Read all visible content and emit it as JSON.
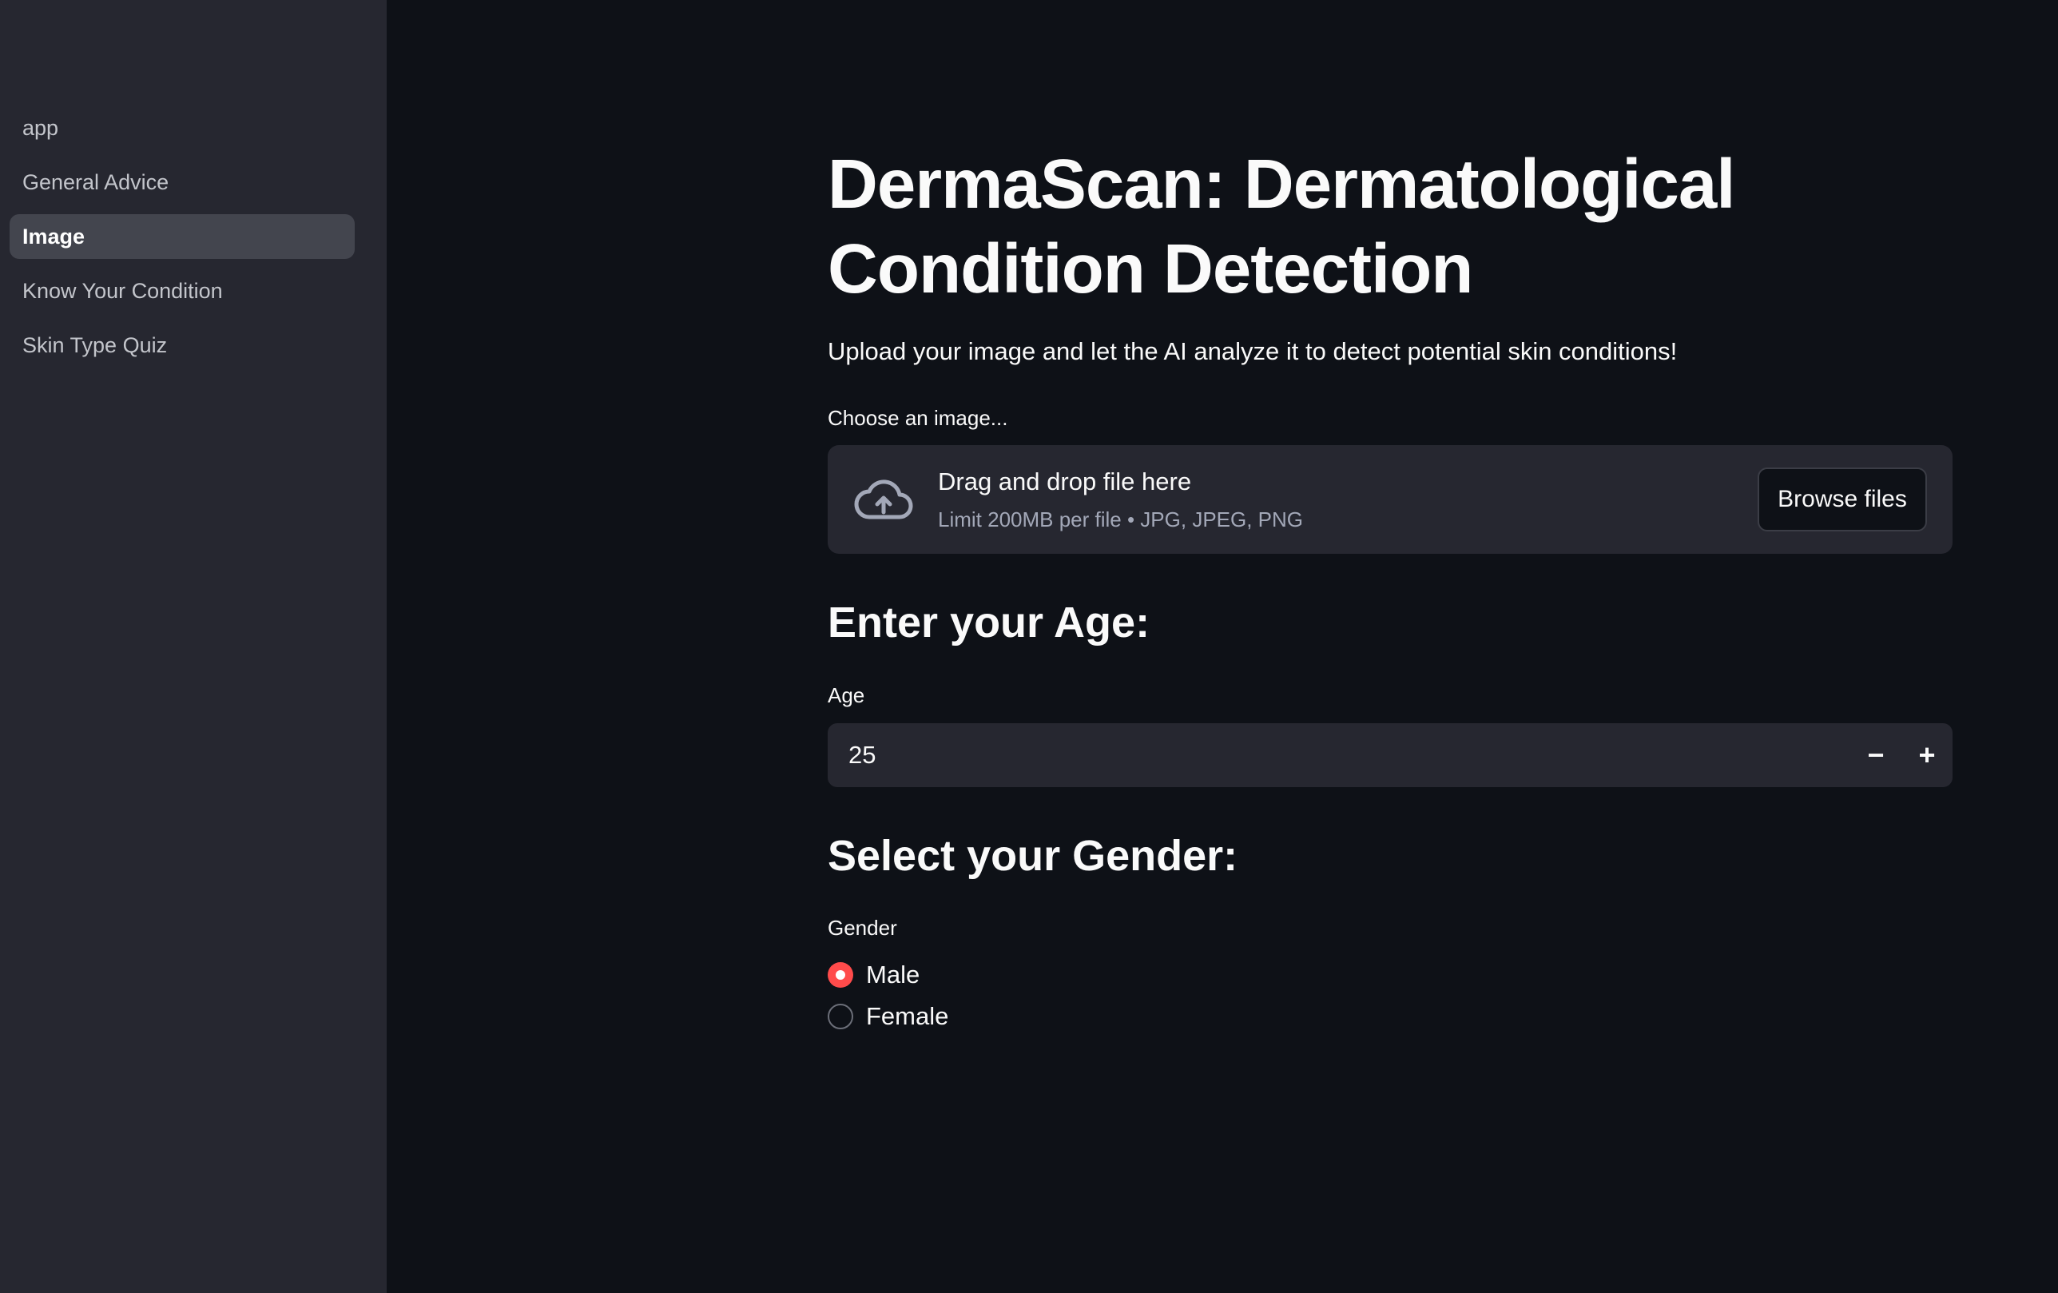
{
  "sidebar": {
    "items": [
      {
        "label": "app",
        "active": false
      },
      {
        "label": "General Advice",
        "active": false
      },
      {
        "label": "Image",
        "active": true
      },
      {
        "label": "Know Your Condition",
        "active": false
      },
      {
        "label": "Skin Type Quiz",
        "active": false
      }
    ]
  },
  "main": {
    "title": "DermaScan: Dermatological Condition Detection",
    "subtitle": "Upload your image and let the AI analyze it to detect potential skin conditions!",
    "uploader": {
      "label": "Choose an image...",
      "drop_title": "Drag and drop file here",
      "drop_sub": "Limit 200MB per file • JPG, JPEG, PNG",
      "browse_label": "Browse files",
      "icon": "cloud-upload-icon"
    },
    "age_section": {
      "heading": "Enter your Age:",
      "label": "Age",
      "value": "25",
      "decrement": "−",
      "increment": "+"
    },
    "gender_section": {
      "heading": "Select your Gender:",
      "label": "Gender",
      "options": [
        "Male",
        "Female"
      ],
      "selected": "Male"
    }
  },
  "colors": {
    "background": "#0e1117",
    "sidebar": "#262730",
    "accent": "#ff4b4b"
  }
}
